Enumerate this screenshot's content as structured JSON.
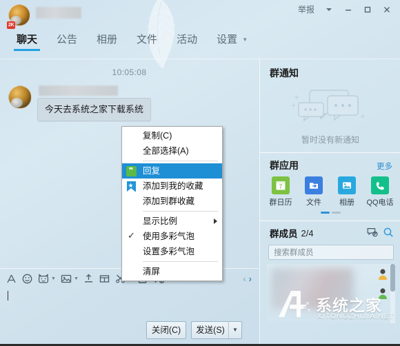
{
  "titlebar": {
    "report_label": "举报",
    "dropdown_icon": "chevron-down-icon",
    "minimize_icon": "minimize-icon",
    "maximize_icon": "maximize-icon",
    "close_icon": "close-icon"
  },
  "header": {
    "avatar_badge": "2K",
    "tabs": [
      {
        "label": "聊天",
        "active": true
      },
      {
        "label": "公告",
        "active": false
      },
      {
        "label": "相册",
        "active": false
      },
      {
        "label": "文件",
        "active": false
      },
      {
        "label": "活动",
        "active": false
      },
      {
        "label": "设置",
        "active": false,
        "has_caret": true
      }
    ]
  },
  "chat": {
    "timestamp": "10:05:08",
    "message_text": "今天去系统之家下载系统"
  },
  "context_menu": {
    "items": [
      {
        "label": "复制(C)",
        "icon": null,
        "selected": false,
        "checked": false,
        "submenu": false
      },
      {
        "label": "全部选择(A)",
        "icon": null,
        "selected": false,
        "checked": false,
        "submenu": false
      },
      {
        "label": "回复",
        "icon": "reply-quote-icon",
        "selected": true,
        "checked": false,
        "submenu": false
      },
      {
        "label": "添加到我的收藏",
        "icon": "bookmark-star-icon",
        "selected": false,
        "checked": false,
        "submenu": false
      },
      {
        "label": "添加到群收藏",
        "icon": null,
        "selected": false,
        "checked": false,
        "submenu": false
      },
      {
        "label": "显示比例",
        "icon": null,
        "selected": false,
        "checked": false,
        "submenu": true
      },
      {
        "label": "使用多彩气泡",
        "icon": null,
        "selected": false,
        "checked": true,
        "submenu": false
      },
      {
        "label": "设置多彩气泡",
        "icon": null,
        "selected": false,
        "checked": false,
        "submenu": false
      },
      {
        "label": "清屏",
        "icon": null,
        "selected": false,
        "checked": false,
        "submenu": false
      }
    ]
  },
  "toolbar": {
    "items": [
      {
        "name": "font-icon",
        "caret": false
      },
      {
        "name": "emoji-icon",
        "caret": false
      },
      {
        "name": "sticker-icon",
        "caret": true
      },
      {
        "name": "image-icon",
        "caret": true
      },
      {
        "name": "upload-file-icon",
        "caret": false
      },
      {
        "name": "screenshot-icon",
        "caret": false
      },
      {
        "name": "scissors-icon",
        "caret": true
      },
      {
        "name": "card-icon",
        "caret": false
      },
      {
        "name": "message-history-icon",
        "caret": true
      }
    ],
    "nav_prev": "‹",
    "nav_next": "›"
  },
  "buttons": {
    "close_label": "关闭(C)",
    "send_label": "发送(S)",
    "send_caret_icon": "chevron-down-icon"
  },
  "sidebar": {
    "notice": {
      "title": "群通知",
      "empty_text": "暂时没有新通知",
      "illustration": "chat-bubbles-empty-icon"
    },
    "apps": {
      "title": "群应用",
      "more_label": "更多",
      "items": [
        {
          "label": "群日历",
          "icon": "calendar-icon",
          "color": "#7dc242"
        },
        {
          "label": "文件",
          "icon": "file-arrow-icon",
          "color": "#3b7fe0"
        },
        {
          "label": "相册",
          "icon": "photo-icon",
          "color": "#29a8e0"
        },
        {
          "label": "QQ电话",
          "icon": "phone-icon",
          "color": "#13c08a"
        }
      ],
      "page_dots": 2,
      "active_dot": 0
    },
    "members": {
      "title": "群成员",
      "count": "2/4",
      "manage_icon": "member-manage-icon",
      "search_icon": "search-icon",
      "search_placeholder": "搜索群成员"
    }
  },
  "watermark": {
    "text": "系统之家",
    "sub": "XITONGZHIJIA.NET"
  },
  "colors": {
    "accent": "#21a0e4",
    "menu_select": "#1e8fd4",
    "link": "#2f8fd0",
    "badge_red": "#e2392c"
  }
}
